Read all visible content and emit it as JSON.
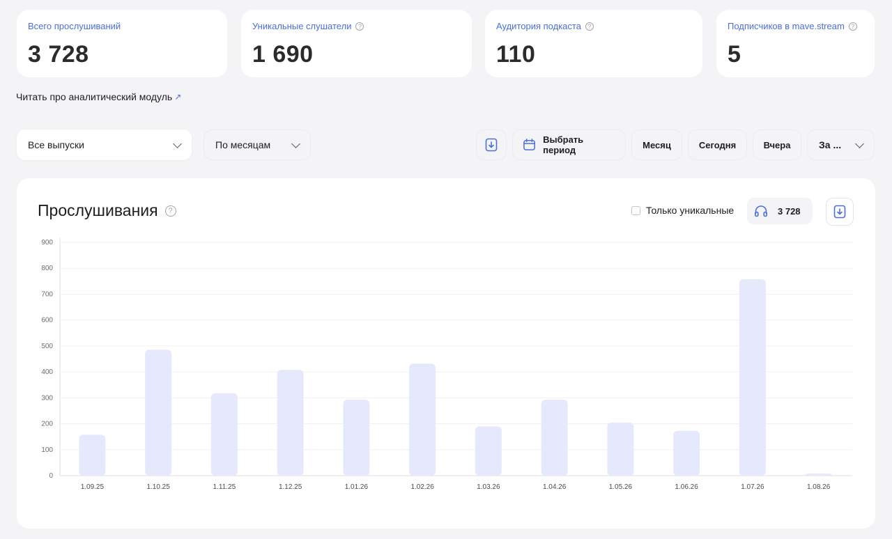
{
  "stats": [
    {
      "label": "Всего прослушиваний",
      "value": "3 728",
      "help": false
    },
    {
      "label": "Уникальные слушатели",
      "value": "1 690",
      "help": true
    },
    {
      "label": "Аудитория подкаста",
      "value": "110",
      "help": true
    },
    {
      "label": "Подписчиков в mave.stream",
      "value": "5",
      "help": true
    }
  ],
  "read_link": {
    "label": "Читать про аналитический модуль",
    "arrow": "↗"
  },
  "filters": {
    "episodes": "Все выпуски",
    "grouping": "По месяцам",
    "choose_period": "Выбрать период",
    "month": "Месяц",
    "today": "Сегодня",
    "yesterday": "Вчера",
    "range_truncated": "За ..."
  },
  "chart_panel": {
    "title": "Прослушивания",
    "unique_only_label": "Только уникальные",
    "unique_only_checked": false,
    "total": "3 728"
  },
  "colors": {
    "accent": "#4a6ee0",
    "bar": "#e6e9fb"
  },
  "chart_data": {
    "type": "bar",
    "categories": [
      "1.09.25",
      "1.10.25",
      "1.11.25",
      "1.12.25",
      "1.01.26",
      "1.02.26",
      "1.03.26",
      "1.04.26",
      "1.05.26",
      "1.06.26",
      "1.07.26",
      "1.08.26"
    ],
    "values": [
      158,
      486,
      318,
      408,
      293,
      432,
      190,
      293,
      205,
      173,
      758,
      8
    ],
    "yticks": [
      0,
      100,
      200,
      300,
      400,
      500,
      600,
      700,
      800,
      900
    ],
    "ylim": [
      0,
      900
    ],
    "grid": true,
    "title": "Прослушивания",
    "xlabel": "",
    "ylabel": ""
  }
}
